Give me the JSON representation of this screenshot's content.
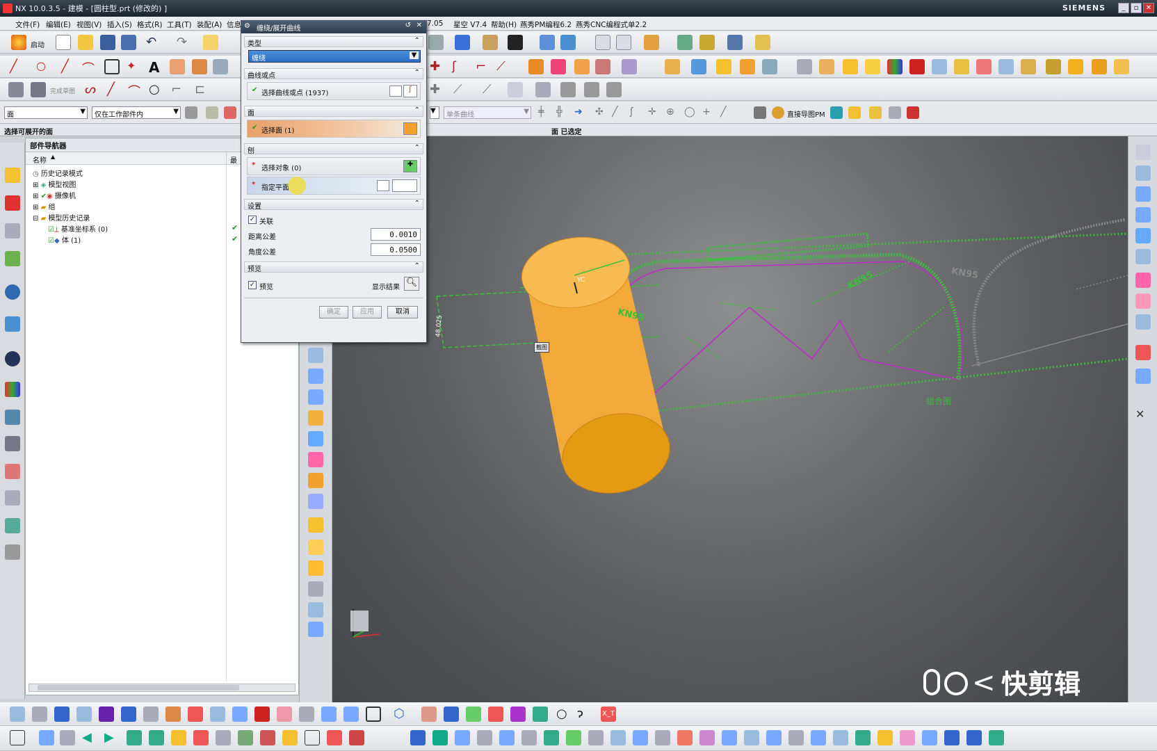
{
  "window": {
    "title": "NX 10.0.3.5 - 建模 - [圆柱型.prt (修改的) ]",
    "brand": "SIEMENS",
    "minimize": "_",
    "restore": "▫",
    "close": "✕"
  },
  "menu": [
    "文件(F)",
    "编辑(E)",
    "视图(V)",
    "插入(S)",
    "格式(R)",
    "工具(T)",
    "装配(A)",
    "信息",
    "7.05",
    "星空 V7.4",
    "帮助(H)",
    "燕秀PM编程6.2",
    "燕秀CNC编程式单2.2"
  ],
  "toolbar": {
    "start_label": "启动",
    "finish_sketch": "完成草图",
    "filter_value": "面",
    "scope_value": "仅在工作部件内",
    "curve_filter_value": "单条曲线",
    "direct_pm": "直接导图PM"
  },
  "selection_bar": {
    "left_label": "选择可展开的面",
    "status": "面 已选定"
  },
  "navigator": {
    "title": "部件导航器",
    "col_name": "名称",
    "col_latest": "最",
    "items": [
      {
        "label": "历史记录模式"
      },
      {
        "label": "模型视图"
      },
      {
        "label": "摄像机"
      },
      {
        "label": "组"
      },
      {
        "label": "模型历史记录"
      },
      {
        "label": "基准坐标系 (0)"
      },
      {
        "label": "体 (1)"
      }
    ]
  },
  "dialog": {
    "title": "缠绕/展开曲线",
    "sections": {
      "type": "类型",
      "curves": "曲线或点",
      "face": "面",
      "plane": "刨",
      "settings": "设置",
      "preview": "预览"
    },
    "type_value": "缠绕",
    "select_curve": "选择曲线或点 (1937)",
    "select_face": "选择面 (1)",
    "select_object": "选择对象 (0)",
    "specify_plane": "指定平面",
    "associative": "关联",
    "distance_tol_label": "距离公差",
    "distance_tol": "0.0010",
    "angle_tol_label": "角度公差",
    "angle_tol": "0.0500",
    "preview_label": "预览",
    "show_result": "显示结果",
    "ok": "确定",
    "apply": "应用",
    "cancel": "取消"
  },
  "viewport": {
    "dimension": "48.025",
    "cs_label": "YC",
    "section_tag": "截图",
    "text1": "KN95",
    "text2": "KN95",
    "text3": "KN95",
    "combo_label": "组合图"
  },
  "watermark": "快剪辑",
  "colors": {
    "cylinder": "#f2a93a",
    "cylinder_end": "#e59a14",
    "curves": "#3bbf3b",
    "magenta": "#c02ac8",
    "viewport_bg": "#5a5b5e"
  }
}
